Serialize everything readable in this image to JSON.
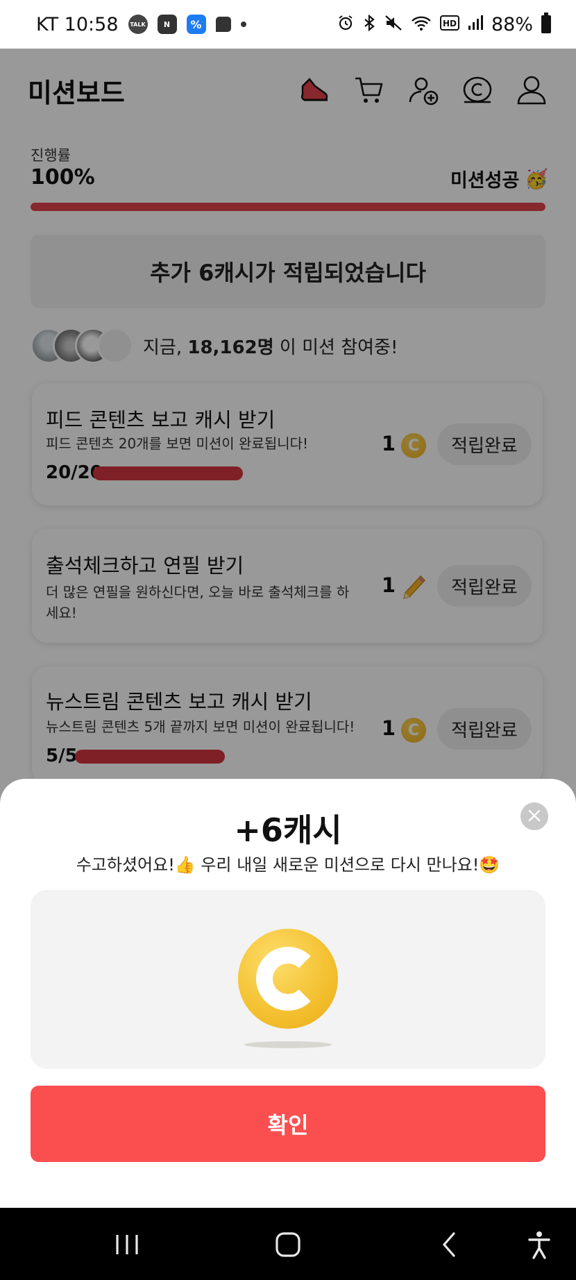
{
  "status_bar": {
    "carrier_time": "KT 10:58",
    "talk_label": "TALK",
    "n_label": "N",
    "pct_label": "%",
    "battery": "88%"
  },
  "header": {
    "title": "미션보드"
  },
  "progress": {
    "label": "진행률",
    "value": "100%",
    "fraction": 1.0,
    "status": "미션성공",
    "status_emoji": "🥳",
    "bar_color": "#e0434b"
  },
  "banner": {
    "text": "추가 6캐시가 적립되었습니다"
  },
  "participants": {
    "prefix": "지금,",
    "count": "18,162명",
    "suffix": "이 미션 참여중!"
  },
  "missions": [
    {
      "title": "피드 콘텐츠 보고 캐시 받기",
      "description": "피드 콘텐츠 20개를 보면 미션이 완료됩니다!",
      "count": "20/20",
      "progress_fraction": 1.0,
      "reward_amount": "1",
      "reward_icon": "coin-icon",
      "button_label": "적립완료"
    },
    {
      "title": "출석체크하고 연필 받기",
      "description": "더 많은 연필을 원하신다면, 오늘 바로 출석체크를 하세요!",
      "reward_amount": "1",
      "reward_icon": "pencil-icon",
      "button_label": "적립완료"
    },
    {
      "title": "뉴스트림 콘텐츠 보고 캐시 받기",
      "description": "뉴스트림 콘텐츠 5개 끝까지 보면 미션이 완료됩니다!",
      "count": "5/5",
      "progress_fraction": 1.0,
      "reward_amount": "1",
      "reward_icon": "coin-icon",
      "button_label": "적립완료"
    }
  ],
  "sheet": {
    "title": "+6캐시",
    "subtitle": "수고하셨어요!👍 우리 내일 새로운 미션으로 다시 만나요!🤩",
    "coin_letter": "C",
    "confirm_label": "확인"
  },
  "colors": {
    "accent_red": "#fb4f4f",
    "progress_red": "#d3363f",
    "coin_gold": "#f4c233"
  }
}
